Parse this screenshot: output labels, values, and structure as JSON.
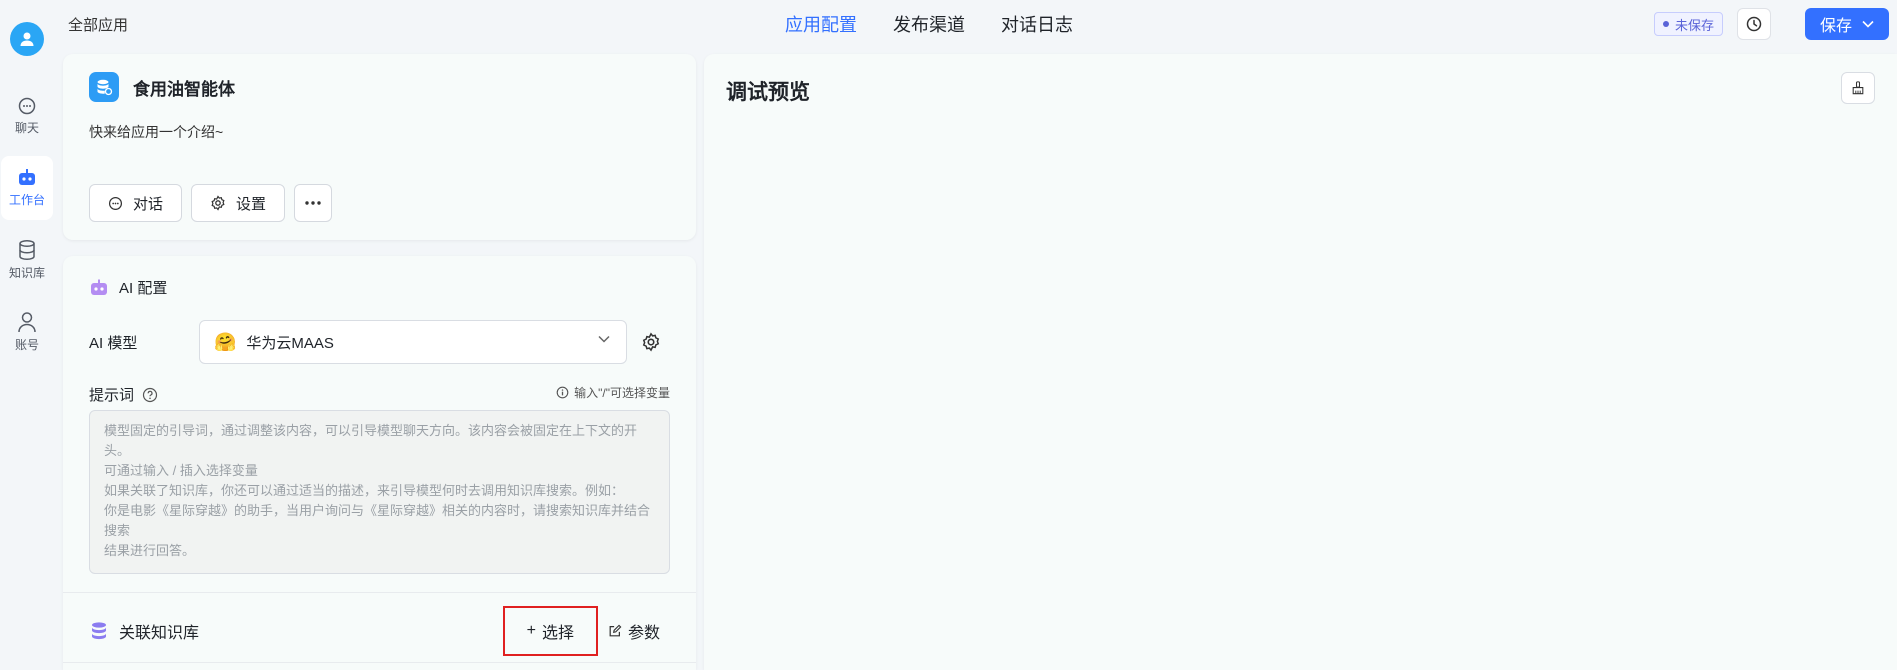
{
  "sidebar": {
    "items": [
      {
        "label": "聊天",
        "icon": "chat-icon"
      },
      {
        "label": "工作台",
        "icon": "robot-icon",
        "active": true
      },
      {
        "label": "知识库",
        "icon": "database-icon"
      },
      {
        "label": "账号",
        "icon": "user-icon"
      }
    ]
  },
  "header": {
    "breadcrumb": "全部应用",
    "tabs": [
      {
        "label": "应用配置",
        "active": true
      },
      {
        "label": "发布渠道"
      },
      {
        "label": "对话日志"
      }
    ],
    "status": "未保存",
    "save_label": "保存"
  },
  "app": {
    "name": "食用油智能体",
    "intro": "快来给应用一个介绍~",
    "chat_label": "对话",
    "settings_label": "设置"
  },
  "config": {
    "title": "AI 配置",
    "model_label": "AI 模型",
    "model_value": "华为云MAAS",
    "prompt_label": "提示词",
    "prompt_hint": "输入\"/\"可选择变量",
    "prompt_placeholder_lines": [
      "模型固定的引导词，通过调整该内容，可以引导模型聊天方向。该内容会被固定在上下文的开头。",
      "可通过输入 / 插入选择变量",
      "如果关联了知识库，你还可以通过适当的描述，来引导模型何时去调用知识库搜索。例如：",
      "你是电影《星际穿越》的助手，当用户询问与《星际穿越》相关的内容时，请搜索知识库并结合搜索",
      "结果进行回答。"
    ],
    "kb_title": "关联知识库",
    "kb_select_label": "选择",
    "kb_params_label": "参数"
  },
  "preview": {
    "title": "调试预览"
  },
  "colors": {
    "accent": "#3370ff",
    "app_icon": "#2d9cf5",
    "highlight": "#e02020"
  }
}
